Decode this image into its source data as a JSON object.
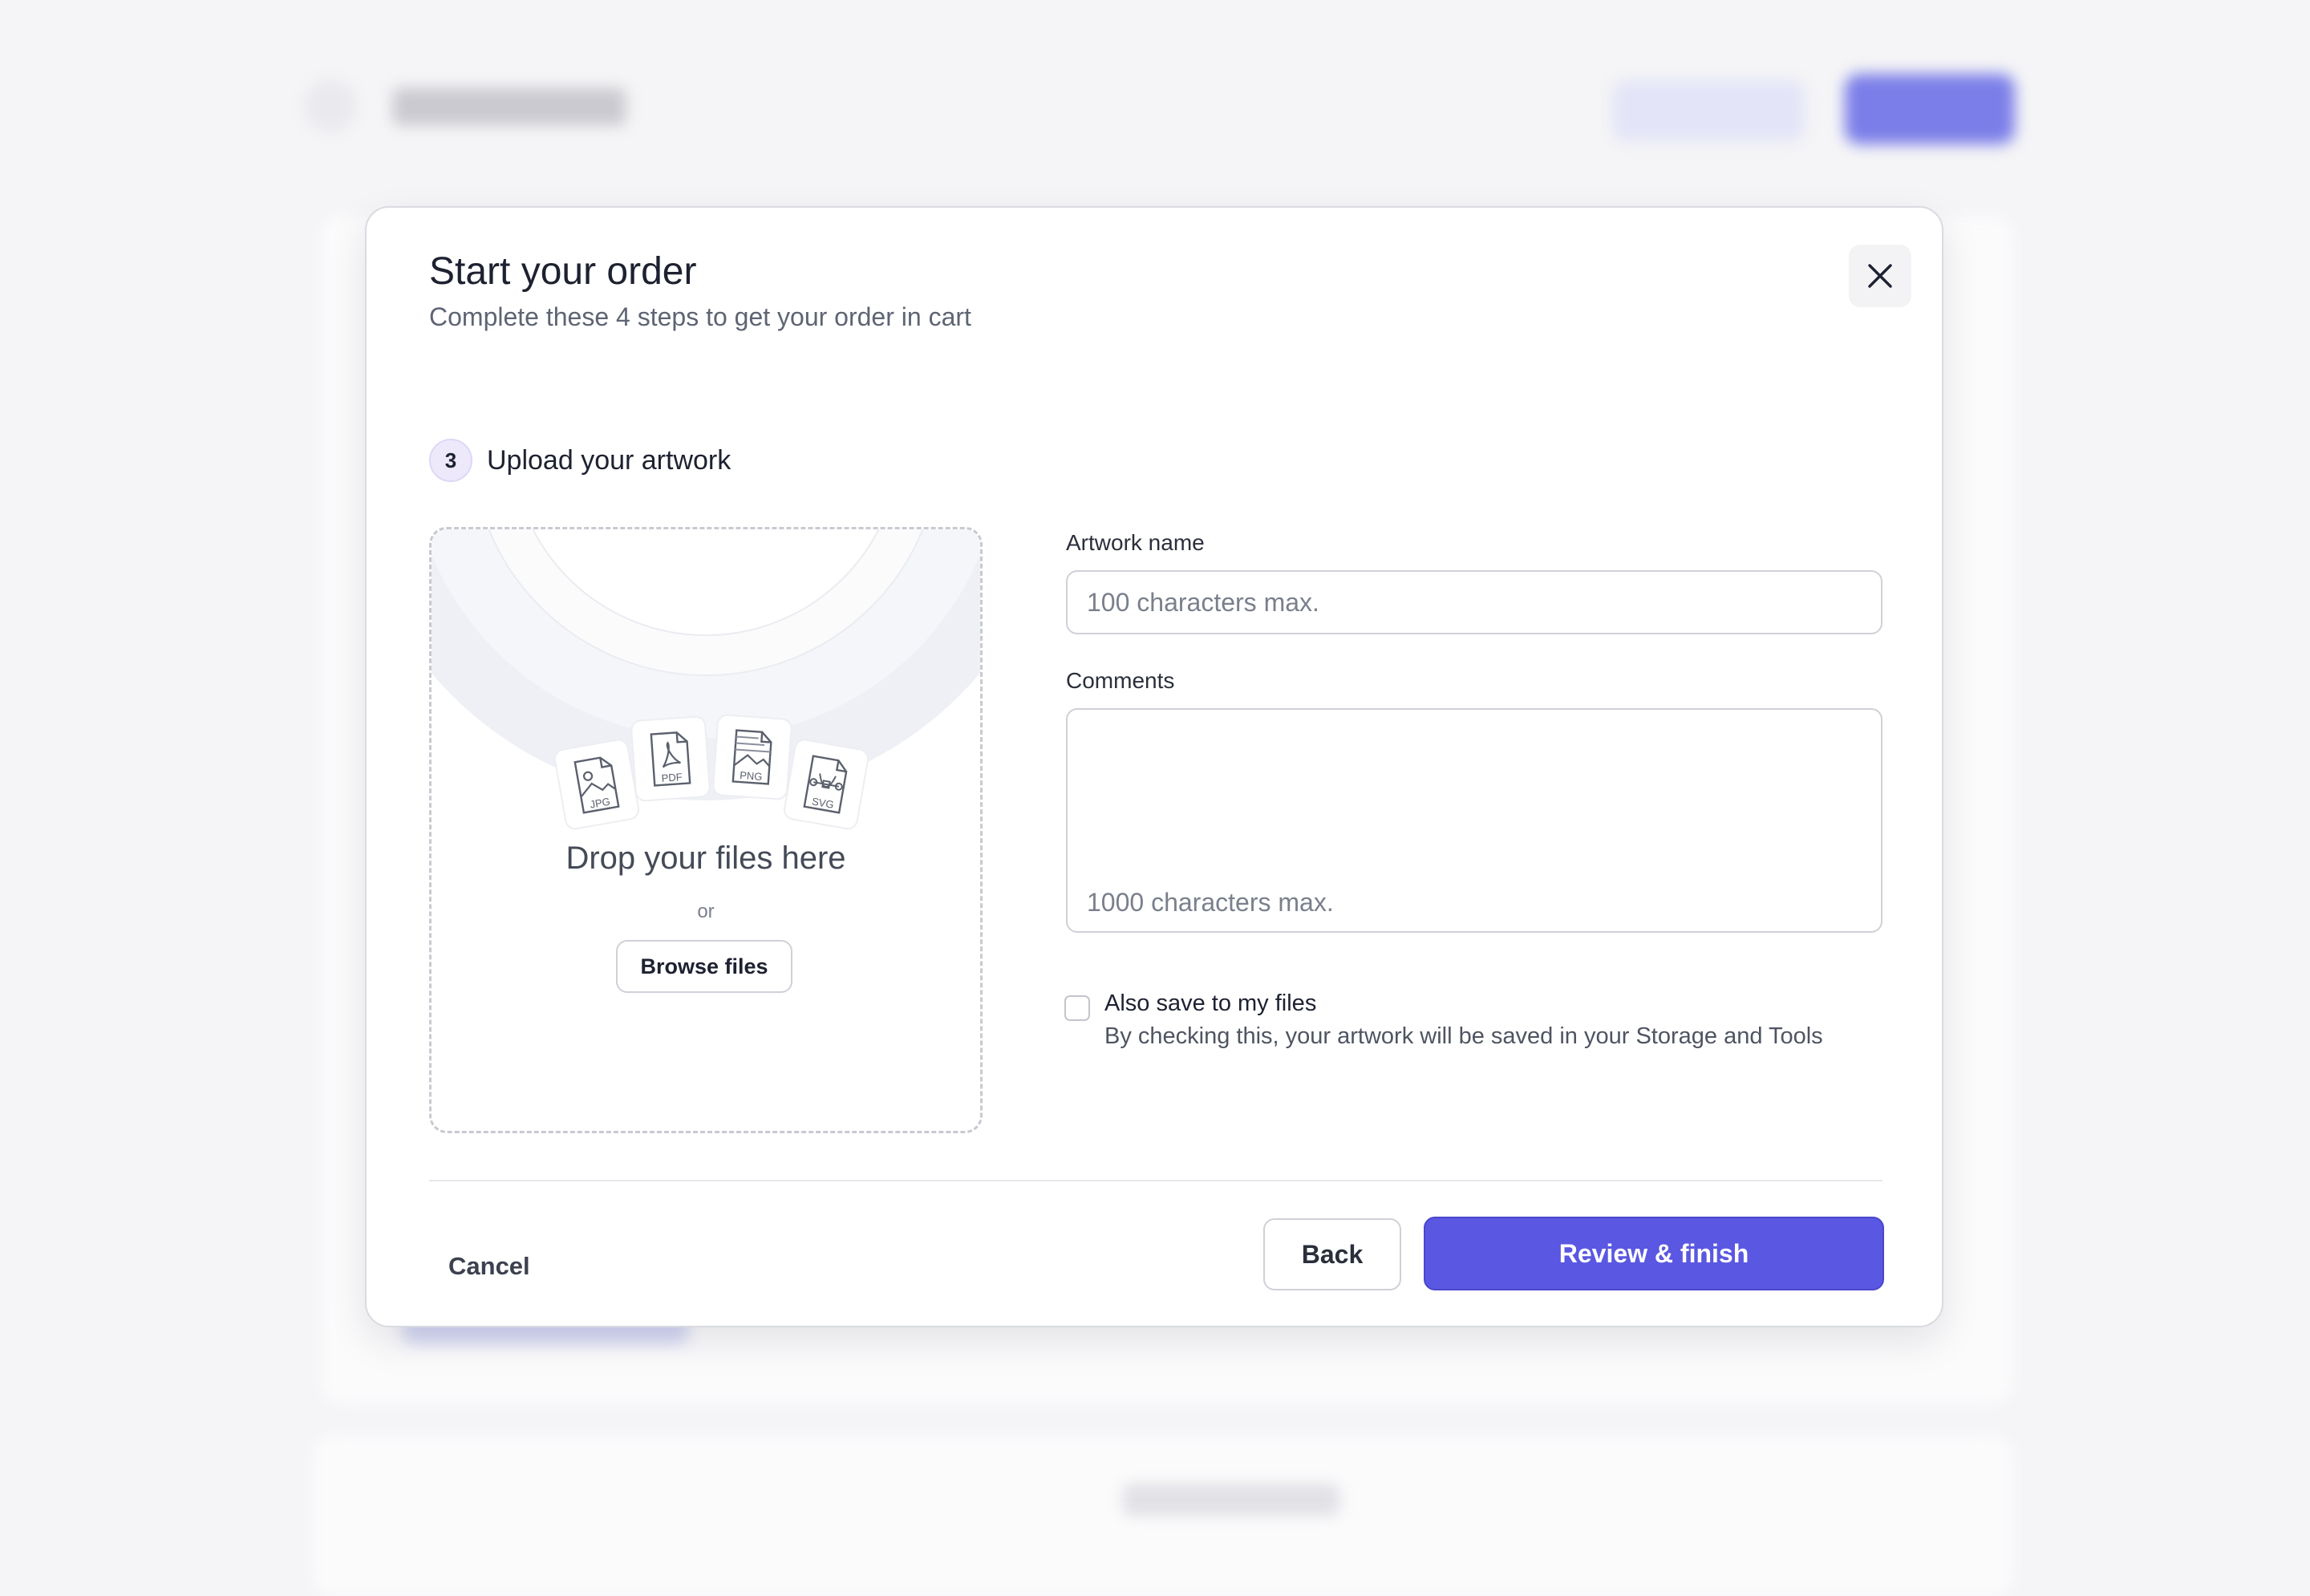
{
  "modal": {
    "title": "Start your order",
    "subtitle": "Complete these 4 steps to get your order in cart",
    "step": {
      "number": "3",
      "label": "Upload your artwork"
    }
  },
  "dropzone": {
    "file_types": [
      "JPG",
      "PDF",
      "PNG",
      "SVG"
    ],
    "title": "Drop your files here",
    "or_text": "or",
    "browse_label": "Browse files"
  },
  "form": {
    "artwork_name": {
      "label": "Artwork name",
      "placeholder": "100 characters max."
    },
    "comments": {
      "label": "Comments",
      "placeholder": "1000 characters max."
    },
    "save_checkbox": {
      "label": "Also save to my files",
      "description": "By checking this, your artwork will be saved in your Storage and Tools",
      "checked": false
    }
  },
  "footer": {
    "cancel_label": "Cancel",
    "back_label": "Back",
    "primary_label": "Review & finish"
  },
  "colors": {
    "primary": "#5a57e2",
    "step_badge_bg": "#ede9fb"
  }
}
